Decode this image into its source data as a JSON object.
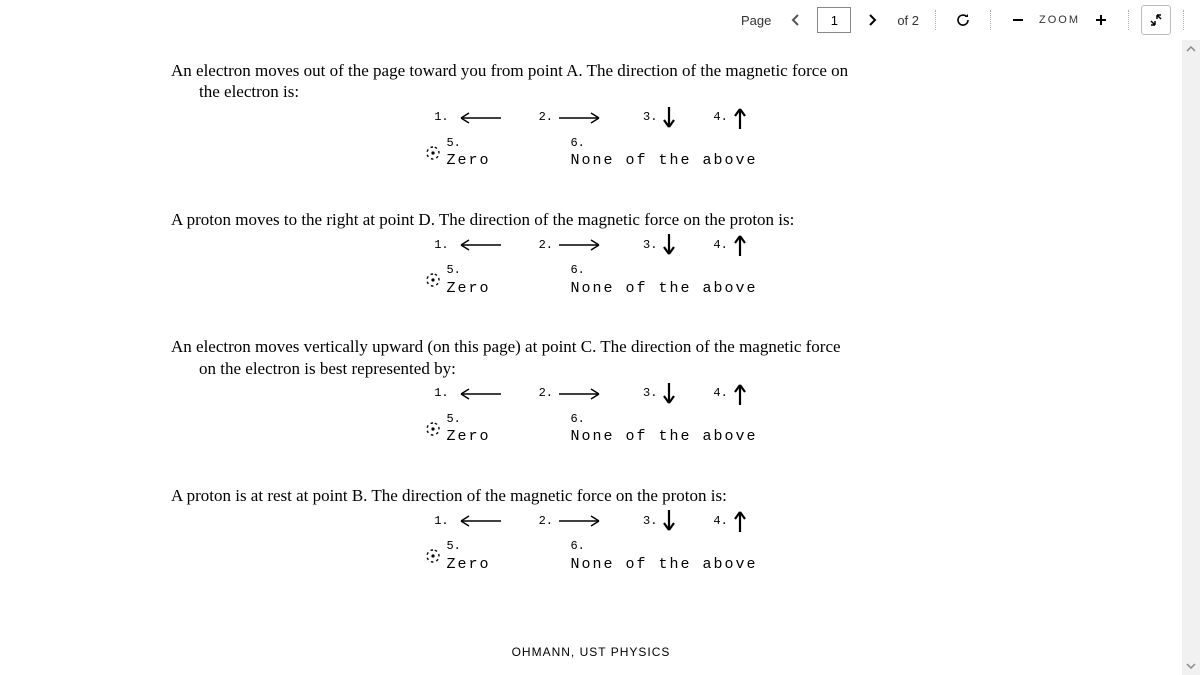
{
  "toolbar": {
    "page_label": "Page",
    "current_page": "1",
    "of_label": "of 2",
    "zoom_label": "ZOOM"
  },
  "questions": [
    {
      "text": "An electron moves out of the page toward you from point A. The direction of the magnetic force on",
      "text2": "the electron is:",
      "opts": {
        "n1": "1.",
        "n2": "2.",
        "n3": "3.",
        "n4": "4.",
        "n5": "5.",
        "zero": "Zero",
        "n6": "6.",
        "none": "None of the above"
      }
    },
    {
      "text": "A proton moves to the right at point D. The direction of the magnetic force on the proton is:",
      "opts": {
        "n1": "1.",
        "n2": "2.",
        "n3": "3.",
        "n4": "4.",
        "n5": "5.",
        "zero": "Zero",
        "n6": "6.",
        "none": "None of the above"
      }
    },
    {
      "text": "An electron moves vertically upward (on this page) at point C. The direction of the magnetic force",
      "text2": "on the electron is best represented by:",
      "opts": {
        "n1": "1.",
        "n2": "2.",
        "n3": "3.",
        "n4": "4.",
        "n5": "5.",
        "zero": "Zero",
        "n6": "6.",
        "none": "None of the above"
      }
    },
    {
      "text": "A proton is at rest at point B. The direction of the magnetic force on the proton is:",
      "opts": {
        "n1": "1.",
        "n2": "2.",
        "n3": "3.",
        "n4": "4.",
        "n5": "5.",
        "zero": "Zero",
        "n6": "6.",
        "none": "None of the above"
      }
    }
  ],
  "footer": {
    "author": "OHMANN, ",
    "dept": "UST PHYSICS"
  }
}
